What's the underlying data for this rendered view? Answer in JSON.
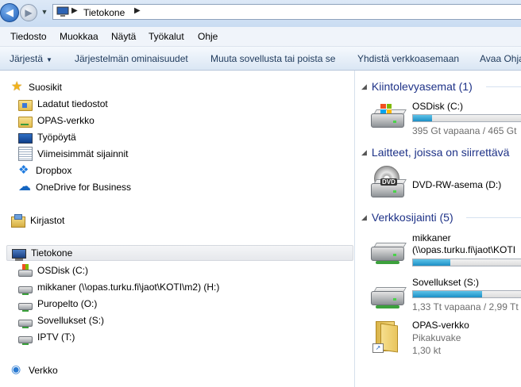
{
  "address": {
    "crumbs": [
      "Tietokone"
    ],
    "icon": "computer-icon"
  },
  "menu": [
    "Tiedosto",
    "Muokkaa",
    "Näytä",
    "Työkalut",
    "Ohje"
  ],
  "commands": {
    "organize": "Järjestä",
    "system_properties": "Järjestelmän ominaisuudet",
    "uninstall": "Muuta sovellusta tai poista se",
    "map_drive": "Yhdistä verkkoasemaan",
    "open_panel": "Avaa Ohja"
  },
  "nav": {
    "favorites": {
      "label": "Suosikit",
      "items": [
        {
          "label": "Ladatut tiedostot",
          "icon": "download-folder-icon"
        },
        {
          "label": "OPAS-verkko",
          "icon": "network-folder-icon"
        },
        {
          "label": "Työpöytä",
          "icon": "desktop-icon"
        },
        {
          "label": "Viimeisimmät sijainnit",
          "icon": "recent-places-icon"
        },
        {
          "label": "Dropbox",
          "icon": "dropbox-icon"
        },
        {
          "label": "OneDrive for Business",
          "icon": "onedrive-icon"
        }
      ]
    },
    "libraries": {
      "label": "Kirjastot"
    },
    "computer": {
      "label": "Tietokone",
      "items": [
        {
          "label": "OSDisk (C:)",
          "icon": "os-drive-icon"
        },
        {
          "label": "mikkaner (\\\\opas.turku.fi\\jaot\\KOTI\\m2) (H:)",
          "icon": "network-drive-icon"
        },
        {
          "label": "Puropelto (O:)",
          "icon": "network-drive-icon"
        },
        {
          "label": "Sovellukset (S:)",
          "icon": "network-drive-icon"
        },
        {
          "label": "IPTV (T:)",
          "icon": "network-drive-icon"
        }
      ]
    },
    "network": {
      "label": "Verkko"
    }
  },
  "content": {
    "hard_drives": {
      "header": "Kiintolevyasemat (1)",
      "items": [
        {
          "name": "OSDisk (C:)",
          "sub": "395 Gt vapaana / 465 Gt",
          "used_fraction": 0.15
        }
      ]
    },
    "removable": {
      "header": "Laitteet, joissa on siirrettävä",
      "items": [
        {
          "name": "DVD-RW-asema (D:)",
          "badge": "DVD"
        }
      ]
    },
    "network_locations": {
      "header": "Verkkosijainti (5)",
      "items": [
        {
          "name": "mikkaner",
          "name2": "(\\\\opas.turku.fi\\jaot\\KOTI",
          "used_fraction": 0.3
        },
        {
          "name": "Sovellukset (S:)",
          "sub": "1,33 Tt vapaana / 2,99 Tt",
          "used_fraction": 0.55
        },
        {
          "name": "OPAS-verkko",
          "sub": "Pikakuvake",
          "sub2": "1,30 kt"
        }
      ]
    }
  }
}
